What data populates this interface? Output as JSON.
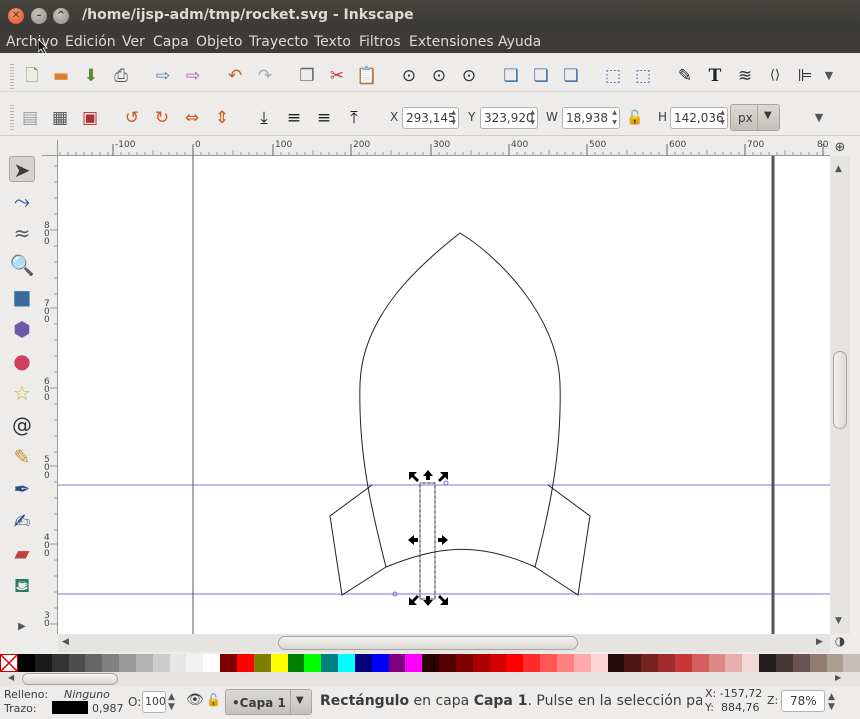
{
  "window": {
    "title": "/home/ijsp-adm/tmp/rocket.svg - Inkscape"
  },
  "menu": [
    "Archivo",
    "Edición",
    "Ver",
    "Capa",
    "Objeto",
    "Trayecto",
    "Texto",
    "Filtros",
    "Extensiones",
    "Ayuda"
  ],
  "toolbar": {
    "x_label": "X",
    "x_value": "293,145",
    "y_label": "Y",
    "y_value": "323,920",
    "w_label": "W",
    "w_value": "18,938",
    "h_label": "H",
    "h_value": "142,036",
    "units": "px"
  },
  "ruler": {
    "h_labels": [
      "-100",
      "0",
      "100",
      "200",
      "300",
      "400",
      "500",
      "600",
      "700",
      "80"
    ],
    "v_labels": [
      "8\n0\n0",
      "7\n0\n0",
      "6\n0\n0",
      "5\n0\n0",
      "4\n0\n0",
      "3\n0"
    ]
  },
  "status": {
    "fill_label": "Relleno:",
    "fill_value": "Ninguno",
    "stroke_label": "Trazo:",
    "stroke_width": "0,987",
    "opacity_label": "O:",
    "opacity_value": "100",
    "layer": "•Capa 1",
    "message_bold": "Rectángulo",
    "message_mid": " en capa ",
    "message_layer": "Capa 1",
    "message_rest": ". Pulse en la selección para c",
    "cursor_x": "X: -157,72",
    "cursor_y": "Y:  884,76",
    "zoom_label": "Z:",
    "zoom_value": "78%"
  },
  "palette": [
    "#000000",
    "#1a1a1a",
    "#333333",
    "#4d4d4d",
    "#666666",
    "#808080",
    "#999999",
    "#b3b3b3",
    "#cccccc",
    "#e6e6e6",
    "#f2f2f2",
    "#ffffff",
    "#800000",
    "#ff0000",
    "#808000",
    "#ffff00",
    "#008000",
    "#00ff00",
    "#008080",
    "#00ffff",
    "#000080",
    "#0000ff",
    "#800080",
    "#ff00ff",
    "#2b0000",
    "#550000",
    "#800000",
    "#aa0000",
    "#d40000",
    "#ff0000",
    "#ff2a2a",
    "#ff5555",
    "#ff8080",
    "#ffaaaa",
    "#ffd5d5",
    "#280b0b",
    "#501616",
    "#782121",
    "#a02c2c",
    "#c83737",
    "#d35f5f",
    "#de8787",
    "#e9afaf",
    "#f4d7d7",
    "#241c1c",
    "#483737",
    "#6c5353",
    "#917c6f",
    "#ac9d93",
    "#c8beb7"
  ]
}
